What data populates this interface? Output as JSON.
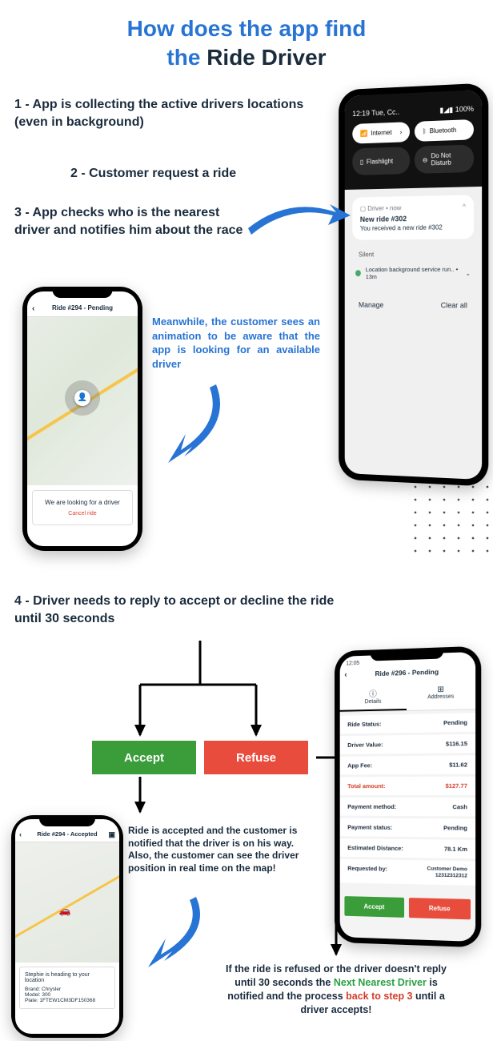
{
  "title": {
    "line1a": "How does the app find",
    "line2a": "the",
    "line2b": "Ride Driver"
  },
  "steps": {
    "s1": "1 - App is collecting the active drivers locations (even in background)",
    "s2": "2 - Customer request a ride",
    "s3": "3 - App checks who is the nearest driver and notifies him about the race",
    "meanwhile": "Meanwhile, the customer sees an animation to be aware that the app is looking for an available driver",
    "s4": "4 - Driver needs to reply to accept or decline the ride until 30 seconds"
  },
  "buttons": {
    "accept": "Accept",
    "refuse": "Refuse"
  },
  "note_accept": "Ride is accepted and the customer is notified that the driver is on his way. Also, the customer can see the driver position in real time on the map!",
  "note_refuse": {
    "p1": "If the ride is refused or the driver doesn't reply until 30 seconds the ",
    "p2": "Next Nearest Driver",
    "p3": " is notified and the process ",
    "p4": "back to step 3",
    "p5": " until a driver accepts!"
  },
  "phoneA": {
    "time": "12:19 Tue, Cc..",
    "battery": "100%",
    "pills": {
      "internet": "Internet",
      "bluetooth": "Bluetooth",
      "flash": "Flashlight",
      "dnd": "Do Not Disturb"
    },
    "notif": {
      "src": "Driver • now",
      "caret": "^",
      "title": "New ride #302",
      "body": "You received a new ride #302"
    },
    "silent": "Silent",
    "bg": "Location background service run..  • 13m",
    "manage": "Manage",
    "clear": "Clear all"
  },
  "phoneB": {
    "head": "Ride #294 - Pending",
    "looking": "We are looking for a driver",
    "cancel": "Cancel ride"
  },
  "phoneC": {
    "time": "12:05",
    "head": "Ride #296 - Pending",
    "tabs": {
      "details": "Details",
      "addresses": "Addresses"
    },
    "rows": {
      "status_l": "Ride Status:",
      "status_v": "Pending",
      "dval_l": "Driver Value:",
      "dval_v": "$116.15",
      "fee_l": "App Fee:",
      "fee_v": "$11.62",
      "tot_l": "Total amount:",
      "tot_v": "$127.77",
      "pm_l": "Payment method:",
      "pm_v": "Cash",
      "ps_l": "Payment status:",
      "ps_v": "Pending",
      "ed_l": "Estimated Distance:",
      "ed_v": "78.1 Km",
      "rb_l": "Requested by:",
      "rb_v1": "Customer Demo",
      "rb_v2": "12312312312"
    },
    "btns": {
      "accept": "Accept",
      "refuse": "Refuse"
    }
  },
  "phoneD": {
    "head": "Ride #294 - Accepted",
    "heading": "Stephie is heading to your location",
    "brand_l": "Brand:",
    "brand_v": "Chrysler",
    "model_l": "Model:",
    "model_v": "300",
    "plate_l": "Plate:",
    "plate_v": "1FTEW1CM3DF150368"
  }
}
